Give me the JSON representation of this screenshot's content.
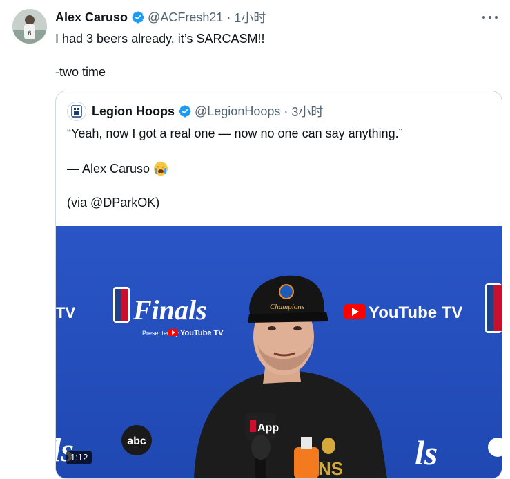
{
  "tweet": {
    "author_name": "Alex Caruso",
    "handle": "@ACFresh21",
    "separator": "·",
    "time": "1小时",
    "text": "I had 3 beers already, it’s SARCASM!!",
    "text_line2": "-two time"
  },
  "quoted": {
    "author_name": "Legion Hoops",
    "handle": "@LegionHoops",
    "separator": "·",
    "time": "3小时",
    "line1": "“Yeah, now I got a real one — now no one can say anything.”",
    "line2": "— Alex Caruso",
    "line3": "(via @DParkOK)"
  },
  "media": {
    "video_time": "1:12",
    "backdrop": {
      "finals_text": "Finals",
      "presented_by": "Presented by",
      "youtubetv": "YouTube TV",
      "tv_fragment": "TV",
      "abc": "abc",
      "hat_text": "Champions",
      "mic_label": "App"
    }
  },
  "colors": {
    "verified": "#1d9bf0",
    "muted_text": "#536471",
    "backdrop_blue": "#2452c2"
  }
}
